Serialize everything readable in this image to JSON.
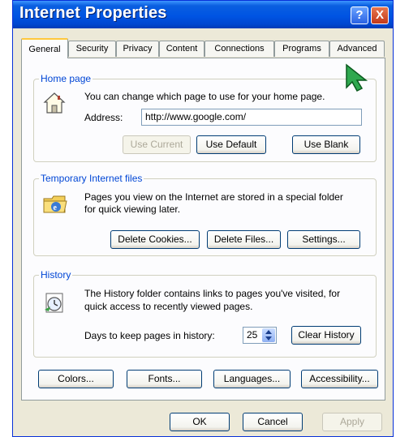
{
  "window": {
    "title": "Internet Properties",
    "help_label": "?",
    "close_label": "X"
  },
  "tabs": [
    "General",
    "Security",
    "Privacy",
    "Content",
    "Connections",
    "Programs",
    "Advanced"
  ],
  "home_page": {
    "legend": "Home page",
    "description": "You can change which page to use for your home page.",
    "address_label": "Address:",
    "address_value": "http://www.google.com/",
    "use_current": "Use Current",
    "use_default": "Use Default",
    "use_blank": "Use Blank"
  },
  "temp_files": {
    "legend": "Temporary Internet files",
    "description_line1": "Pages you view on the Internet are stored in a special folder",
    "description_line2": "for quick viewing later.",
    "delete_cookies": "Delete Cookies...",
    "delete_files": "Delete Files...",
    "settings": "Settings..."
  },
  "history": {
    "legend": "History",
    "description_line1": "The History folder contains links to pages you've visited, for",
    "description_line2": "quick access to recently viewed pages.",
    "days_label": "Days to keep pages in history:",
    "days_value": "25",
    "clear_history": "Clear History"
  },
  "bottom_buttons": {
    "colors": "Colors...",
    "fonts": "Fonts...",
    "languages": "Languages...",
    "accessibility": "Accessibility..."
  },
  "dialog_buttons": {
    "ok": "OK",
    "cancel": "Cancel",
    "apply": "Apply"
  },
  "icons": {
    "home": "home-icon",
    "ie_folder": "ie-folder-icon",
    "history": "history-clock-icon",
    "cursor": "mouse-pointer-icon"
  },
  "colors": {
    "titlebar": "#0054e3",
    "legend_text": "#0046d5",
    "active_tab_accent": "#ffc83c",
    "cursor": "#2fa84f"
  }
}
